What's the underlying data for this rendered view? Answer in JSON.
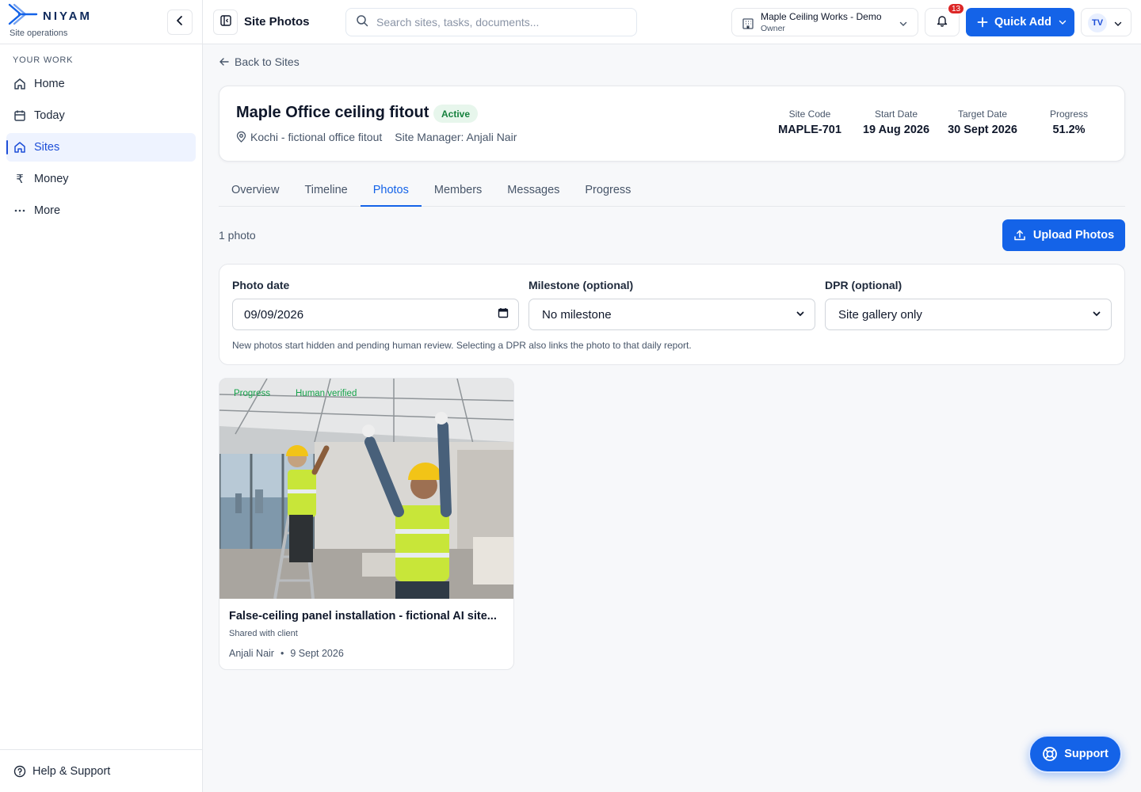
{
  "brand": {
    "name": "NIYAM",
    "subtitle": "Site operations"
  },
  "sidebar": {
    "section_label": "YOUR WORK",
    "items": [
      {
        "label": "Home",
        "icon": "home-icon"
      },
      {
        "label": "Today",
        "icon": "calendar-icon"
      },
      {
        "label": "Sites",
        "icon": "home-icon",
        "active": true
      },
      {
        "label": "Money",
        "icon": "rupee-icon"
      },
      {
        "label": "More",
        "icon": "more-horizontal-icon"
      }
    ],
    "help_label": "Help & Support"
  },
  "topbar": {
    "title": "Site Photos",
    "search_placeholder": "Search sites, tasks, documents...",
    "org_name": "Maple Ceiling Works - Demo",
    "org_role": "Owner",
    "notification_count": "13",
    "quick_add_label": "Quick Add",
    "avatar_initials": "TV"
  },
  "page": {
    "back_label": "Back to Sites",
    "site_name": "Maple Office ceiling fitout",
    "status": "Active",
    "location": "Kochi - fictional office fitout",
    "manager": "Site Manager: Anjali Nair",
    "stats": [
      {
        "label": "Site Code",
        "value": "MAPLE-701"
      },
      {
        "label": "Start Date",
        "value": "19 Aug 2026"
      },
      {
        "label": "Target Date",
        "value": "30 Sept 2026"
      },
      {
        "label": "Progress",
        "value": "51.2%"
      }
    ],
    "tabs": [
      "Overview",
      "Timeline",
      "Photos",
      "Members",
      "Messages",
      "Progress"
    ],
    "active_tab": "Photos",
    "photo_count": "1 photo",
    "upload_label": "Upload Photos"
  },
  "filters": {
    "photo_date_label": "Photo date",
    "photo_date_value": "09/09/2026",
    "milestone_label": "Milestone (optional)",
    "milestone_value": "No milestone",
    "dpr_label": "DPR (optional)",
    "dpr_value": "Site gallery only",
    "note": "New photos start hidden and pending human review. Selecting a DPR also links the photo to that daily report."
  },
  "photos": [
    {
      "tags": [
        "Progress",
        "Human verified"
      ],
      "title": "False-ceiling panel installation - fictional AI site...",
      "visibility": "Shared with client",
      "author": "Anjali Nair",
      "date": "9 Sept 2026"
    }
  ],
  "support_label": "Support",
  "colors": {
    "primary": "#1463e8",
    "active_badge_bg": "#e7f6ec",
    "active_badge_text": "#15803d",
    "notification": "#dc2626"
  }
}
